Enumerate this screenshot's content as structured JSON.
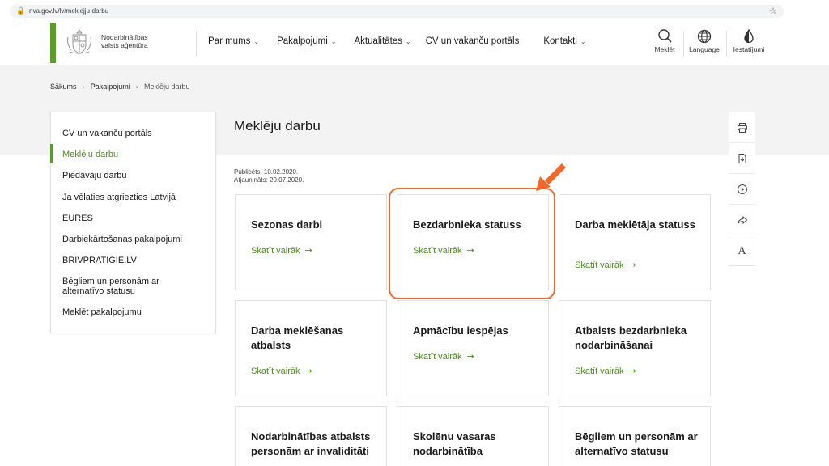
{
  "browser": {
    "url": "nva.gov.lv/lv/meklejju-darbu",
    "lock_icon": "lock-icon",
    "star_icon": "star-icon"
  },
  "header": {
    "logo_text_line1": "Nodarbinātības",
    "logo_text_line2": "valsts aģentūra",
    "nav": [
      {
        "label": "Par mums",
        "has_dropdown": true
      },
      {
        "label": "Pakalpojumi",
        "has_dropdown": true
      },
      {
        "label": "Aktualitātes",
        "has_dropdown": true
      },
      {
        "label": "CV un vakanču portāls",
        "has_dropdown": false
      },
      {
        "label": "Kontakti",
        "has_dropdown": true
      }
    ],
    "tools": {
      "search": "Meklēt",
      "language": "Language",
      "settings": "Iestatījumi"
    }
  },
  "breadcrumb": {
    "home": "Sākums",
    "section": "Pakalpojumi",
    "current": "Meklēju darbu"
  },
  "sidebar": {
    "items": [
      {
        "label": "CV un vakanču portāls",
        "active": false
      },
      {
        "label": "Meklēju darbu",
        "active": true
      },
      {
        "label": "Piedāvāju darbu",
        "active": false
      },
      {
        "label": "Ja vēlaties atgriezties Latvijā",
        "active": false
      },
      {
        "label": "EURES",
        "active": false
      },
      {
        "label": "Darbiekārtošanas pakalpojumi",
        "active": false
      },
      {
        "label": "BRIVPRATIGIE.LV",
        "active": false
      },
      {
        "label": "Bēgliem un personām ar alternatīvo statusu",
        "active": false
      },
      {
        "label": "Meklēt pakalpojumu",
        "active": false
      }
    ]
  },
  "main": {
    "title": "Meklēju darbu",
    "published": "Publicēts: 10.02.2020.",
    "updated": "Atjaunināts: 20.07.2020.",
    "link_label": "Skatīt vairāk",
    "link_arrow": "→",
    "cards": [
      {
        "title": "Sezonas darbi"
      },
      {
        "title": "Bezdarbnieka statuss"
      },
      {
        "title": "Darba meklētāja statuss"
      },
      {
        "title": "Darba meklēšanas atbalsts"
      },
      {
        "title": "Apmācību iespējas"
      },
      {
        "title": "Atbalsts bezdarbnieka nodarbināšanai"
      },
      {
        "title": "Nodarbinātības atbalsts personām ar invaliditāti"
      },
      {
        "title": "Skolēnu vasaras nodarbinātība"
      },
      {
        "title": "Bēgliem un personām ar alternatīvo statusu"
      }
    ]
  },
  "rail": {
    "items": [
      "print-icon",
      "document-icon",
      "play-icon",
      "share-icon",
      "font-size-icon"
    ],
    "font_letter": "A"
  },
  "colors": {
    "accent_green": "#5b9b2a",
    "link_green": "#4e8f22",
    "highlight_orange": "#f2682a"
  }
}
